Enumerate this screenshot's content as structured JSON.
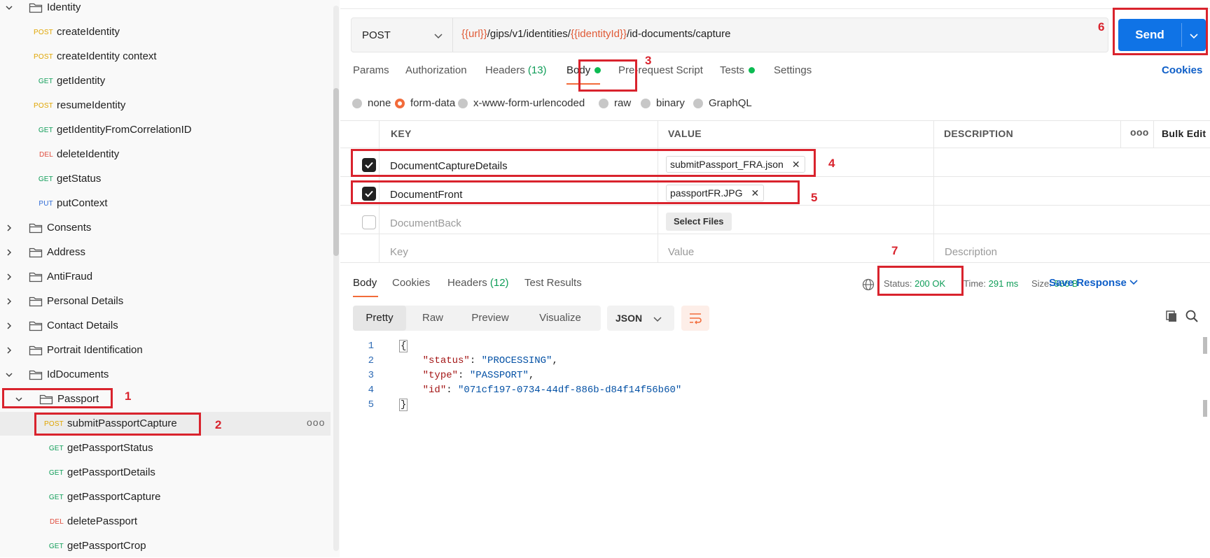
{
  "sidebar": {
    "rows": [
      {
        "kind": "folder",
        "label": "Identity",
        "expanded": true
      },
      {
        "kind": "request",
        "method": "POST",
        "label": "createIdentity"
      },
      {
        "kind": "request",
        "method": "POST",
        "label": "createIdentity context"
      },
      {
        "kind": "request",
        "method": "GET",
        "label": "getIdentity"
      },
      {
        "kind": "request",
        "method": "POST",
        "label": "resumeIdentity"
      },
      {
        "kind": "request",
        "method": "GET",
        "label": "getIdentityFromCorrelationID"
      },
      {
        "kind": "request",
        "method": "DEL",
        "label": "deleteIdentity"
      },
      {
        "kind": "request",
        "method": "GET",
        "label": "getStatus"
      },
      {
        "kind": "request",
        "method": "PUT",
        "label": "putContext"
      },
      {
        "kind": "folder",
        "label": "Consents",
        "expanded": false
      },
      {
        "kind": "folder",
        "label": "Address",
        "expanded": false
      },
      {
        "kind": "folder",
        "label": "AntiFraud",
        "expanded": false
      },
      {
        "kind": "folder",
        "label": "Personal Details",
        "expanded": false
      },
      {
        "kind": "folder",
        "label": "Contact Details",
        "expanded": false
      },
      {
        "kind": "folder",
        "label": "Portrait Identification",
        "expanded": false
      },
      {
        "kind": "folder",
        "label": "IdDocuments",
        "expanded": true
      },
      {
        "kind": "subfolder",
        "label": "Passport",
        "expanded": true
      },
      {
        "kind": "subrequest",
        "method": "POST",
        "label": "submitPassportCapture",
        "selected": true
      },
      {
        "kind": "subrequest",
        "method": "GET",
        "label": "getPassportStatus"
      },
      {
        "kind": "subrequest",
        "method": "GET",
        "label": "getPassportDetails"
      },
      {
        "kind": "subrequest",
        "method": "GET",
        "label": "getPassportCapture"
      },
      {
        "kind": "subrequest",
        "method": "DEL",
        "label": "deletePassport"
      },
      {
        "kind": "subrequest",
        "method": "GET",
        "label": "getPassportCrop"
      }
    ],
    "more_label": "ooo"
  },
  "request": {
    "method": "POST",
    "url_parts": [
      {
        "text": "{{url}}",
        "var": true
      },
      {
        "text": "/gips/v1/identities/",
        "var": false
      },
      {
        "text": "{{identityId}}",
        "var": true
      },
      {
        "text": "/id-documents/capture",
        "var": false
      }
    ],
    "send_label": "Send"
  },
  "tabs": {
    "params": "Params",
    "authorization": "Authorization",
    "headers": "Headers",
    "headers_count": "(13)",
    "body": "Body",
    "prerequest": "Pre-request Script",
    "tests": "Tests",
    "settings": "Settings",
    "cookies": "Cookies"
  },
  "body_types": [
    "none",
    "form-data",
    "x-www-form-urlencoded",
    "raw",
    "binary",
    "GraphQL"
  ],
  "body_type_selected": "form-data",
  "form": {
    "headers": {
      "key": "KEY",
      "value": "VALUE",
      "description": "DESCRIPTION",
      "more": "ooo",
      "bulk": "Bulk Edit"
    },
    "rows": [
      {
        "checked": true,
        "key": "DocumentCaptureDetails",
        "file": "submitPassport_FRA.json"
      },
      {
        "checked": true,
        "key": "DocumentFront",
        "file": "passportFR.JPG"
      },
      {
        "checked": false,
        "key": "DocumentBack",
        "select_files": "Select Files"
      }
    ],
    "placeholders": {
      "key": "Key",
      "value": "Value",
      "description": "Description"
    }
  },
  "response": {
    "tabs": {
      "body": "Body",
      "cookies": "Cookies",
      "headers": "Headers",
      "headers_count": "(12)",
      "tests": "Test Results"
    },
    "status_label": "Status:",
    "status_value": "200 OK",
    "time_label": "Time:",
    "time_value": "291 ms",
    "size_label": "Size:",
    "size_value": "586 B",
    "save_label": "Save Response",
    "views": [
      "Pretty",
      "Raw",
      "Preview",
      "Visualize"
    ],
    "view_selected": "Pretty",
    "format": "JSON",
    "lines": [
      {
        "n": "1",
        "text": "{"
      },
      {
        "n": "2",
        "key": "\"status\"",
        "value": "\"PROCESSING\"",
        "comma": ","
      },
      {
        "n": "3",
        "key": "\"type\"",
        "value": "\"PASSPORT\"",
        "comma": ","
      },
      {
        "n": "4",
        "key": "\"id\"",
        "value": "\"071cf197-0734-44df-886b-d84f14f56b60\"",
        "comma": ""
      },
      {
        "n": "5",
        "text": "}"
      }
    ]
  },
  "annotations": [
    "1",
    "2",
    "3",
    "4",
    "5",
    "6",
    "7"
  ],
  "colors": {
    "accent": "#f26b3a",
    "send": "#0f73e6",
    "annotation": "#d9232d",
    "ok": "#0f9d58"
  }
}
